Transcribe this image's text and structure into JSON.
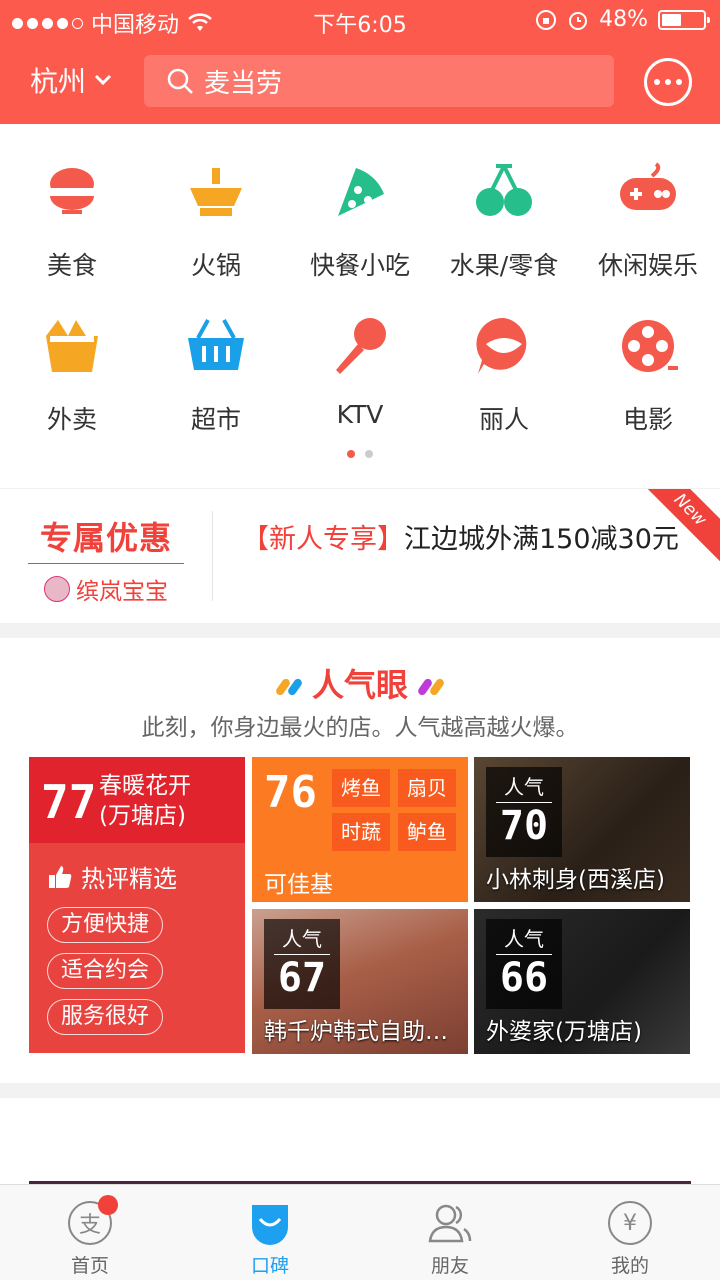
{
  "status": {
    "carrier": "中国移动",
    "time": "下午6:05",
    "battery": "48%",
    "battery_level": 0.48
  },
  "header": {
    "city": "杭州",
    "search_text": "麦当劳"
  },
  "categories": [
    {
      "label": "美食",
      "icon": "bowl-icon",
      "color": "#f45a4c"
    },
    {
      "label": "火锅",
      "icon": "hotpot-icon",
      "color": "#f5a623"
    },
    {
      "label": "快餐小吃",
      "icon": "pizza-icon",
      "color": "#26bf8c"
    },
    {
      "label": "水果/零食",
      "icon": "cherry-icon",
      "color": "#26bf8c"
    },
    {
      "label": "休闲娱乐",
      "icon": "gamepad-icon",
      "color": "#f45a4c"
    },
    {
      "label": "外卖",
      "icon": "takeout-icon",
      "color": "#f5a623"
    },
    {
      "label": "超市",
      "icon": "basket-icon",
      "color": "#1aa0e8"
    },
    {
      "label": "KTV",
      "icon": "microphone-icon",
      "color": "#f45a4c"
    },
    {
      "label": "丽人",
      "icon": "beauty-icon",
      "color": "#f45a4c"
    },
    {
      "label": "电影",
      "icon": "film-reel-icon",
      "color": "#f45a4c"
    }
  ],
  "promo": {
    "brand_title": "专属优惠",
    "brand_user": "缤岚宝宝",
    "tag": "【新人专享】",
    "text": "江边城外满150减30元",
    "new_label": "New"
  },
  "hot": {
    "title": "人气眼",
    "subtitle": "此刻，你身边最火的店。人气越高越火爆。",
    "tile1": {
      "score": "77",
      "name_line1": "春暖花开",
      "name_line2": "(万塘店)",
      "hot_label": "热评精选",
      "pills": [
        "方便快捷",
        "适合约会",
        "服务很好"
      ]
    },
    "tile2": {
      "score": "76",
      "tags": [
        "烤鱼",
        "扇贝",
        "时蔬",
        "鲈鱼"
      ],
      "name": "可佳基"
    },
    "tile3": {
      "badge_label": "人气",
      "score": "70",
      "name": "小林刺身(西溪店)"
    },
    "tile4": {
      "badge_label": "人气",
      "score": "67",
      "name": "韩千炉韩式自助烤肉"
    },
    "tile5": {
      "badge_label": "人气",
      "score": "66",
      "name": "外婆家(万塘店)"
    }
  },
  "tabs": [
    {
      "label": "首页",
      "icon": "alipay-icon",
      "glyph": "支"
    },
    {
      "label": "口碑",
      "icon": "koubei-icon",
      "glyph": ""
    },
    {
      "label": "朋友",
      "icon": "friends-icon",
      "glyph": ""
    },
    {
      "label": "我的",
      "icon": "wallet-icon",
      "glyph": "¥"
    }
  ]
}
